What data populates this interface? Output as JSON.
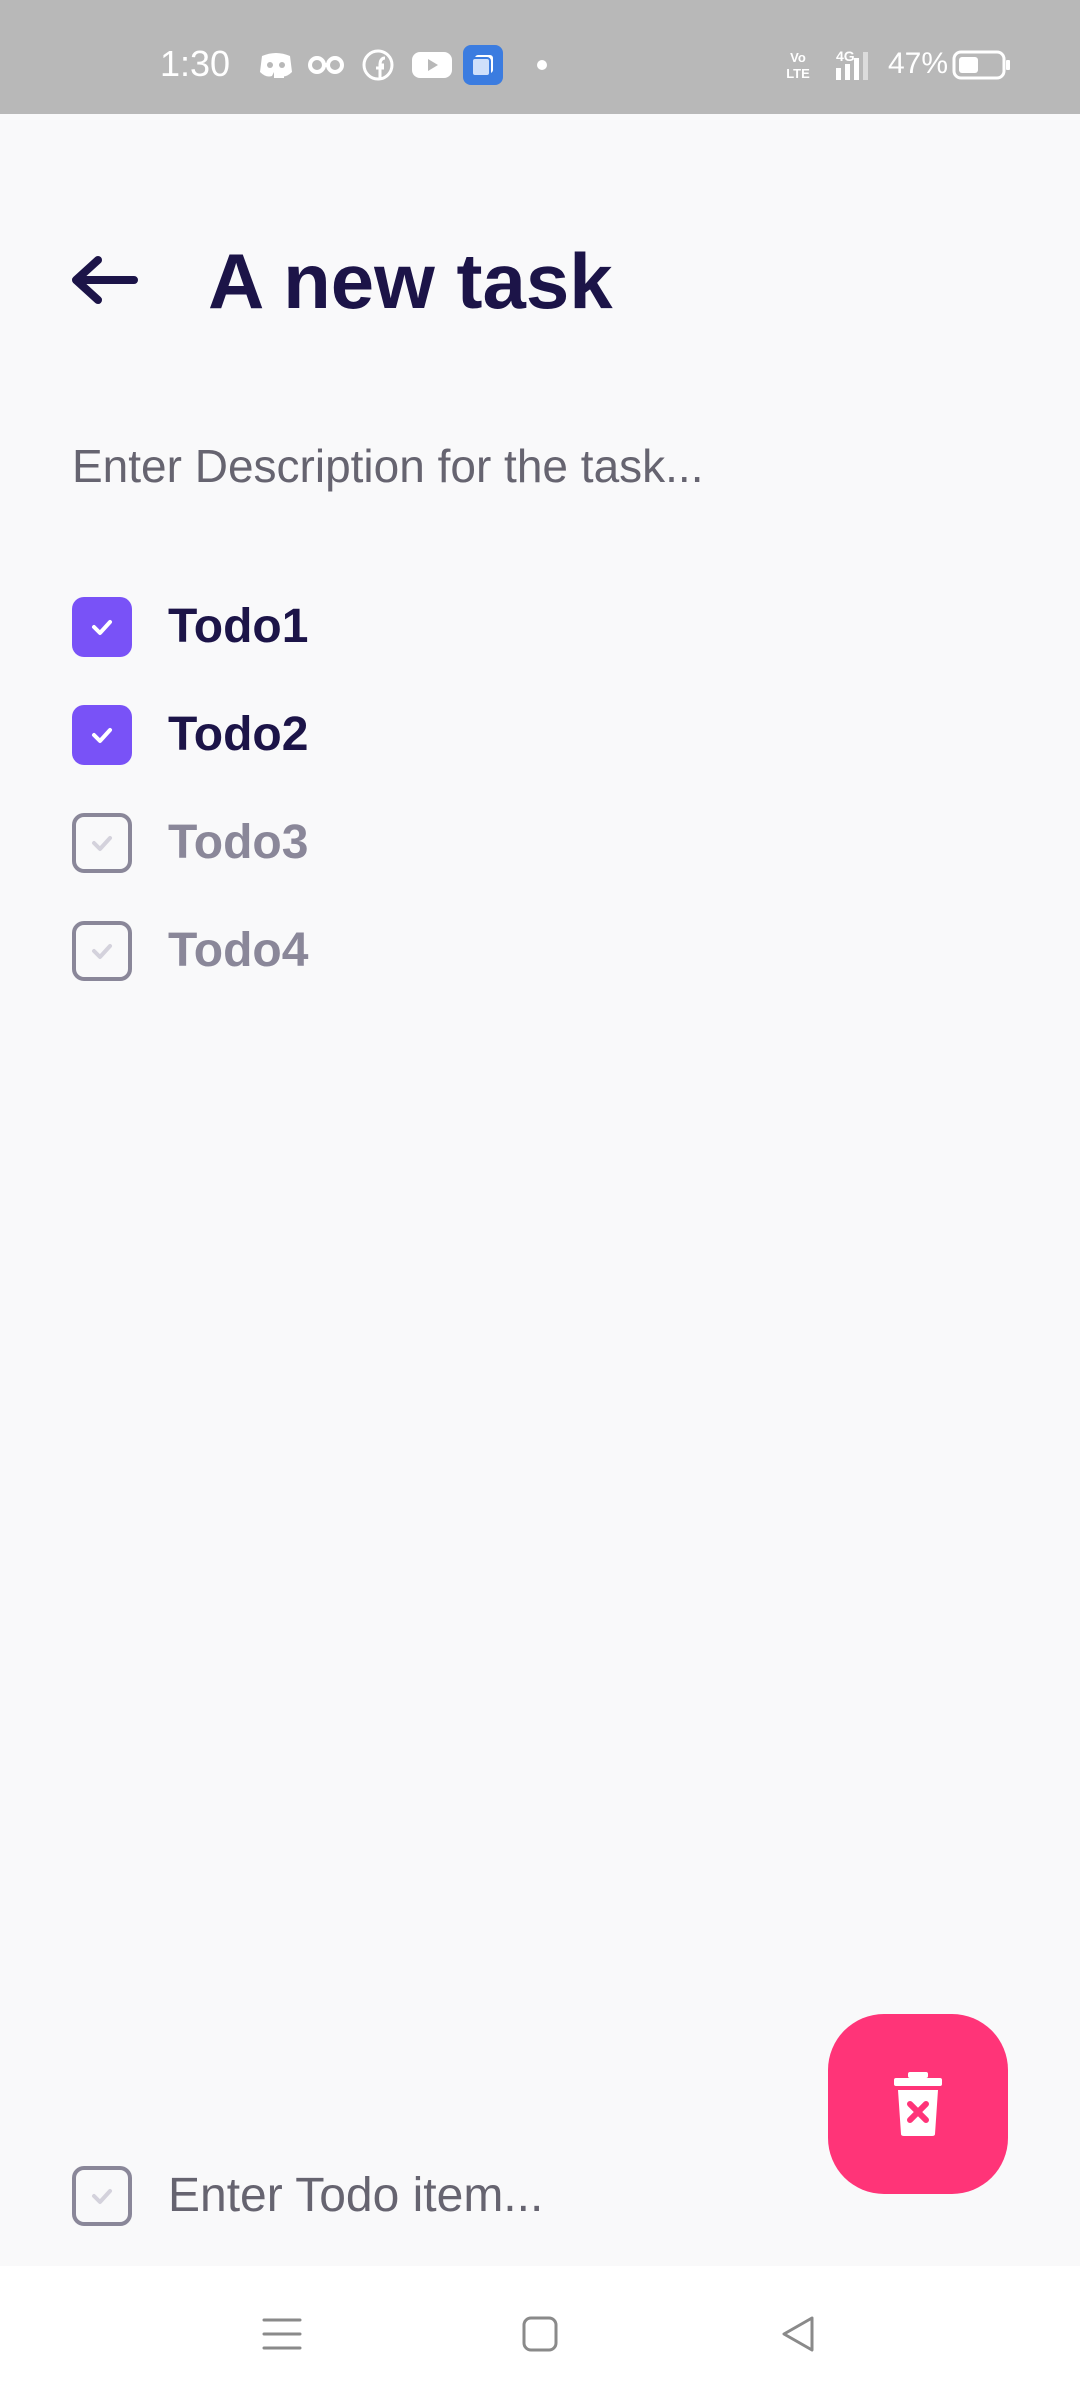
{
  "status_bar": {
    "time": "1:30",
    "battery_percent": "47%",
    "network": "4G",
    "icons": [
      "discord-icon",
      "glasses-icon",
      "facebook-icon",
      "youtube-icon",
      "app-icon",
      "dot-icon",
      "volte-icon",
      "signal-icon",
      "battery-icon"
    ],
    "battery_level": 0.47
  },
  "header": {
    "title": "A new task",
    "back_icon": "arrow-left-icon"
  },
  "description": {
    "placeholder": "Enter Description for the task..."
  },
  "todos": [
    {
      "label": "Todo1",
      "checked": true
    },
    {
      "label": "Todo2",
      "checked": true
    },
    {
      "label": "Todo3",
      "checked": false
    },
    {
      "label": "Todo4",
      "checked": false
    }
  ],
  "new_todo": {
    "placeholder": "Enter Todo item..."
  },
  "fab": {
    "icon": "delete-icon"
  },
  "nav": {
    "items": [
      "menu-icon",
      "home-icon",
      "back-icon"
    ]
  },
  "colors": {
    "accent": "#7952f7",
    "title": "#1c1448",
    "fab": "#ff3478",
    "muted": "#8a8799"
  }
}
